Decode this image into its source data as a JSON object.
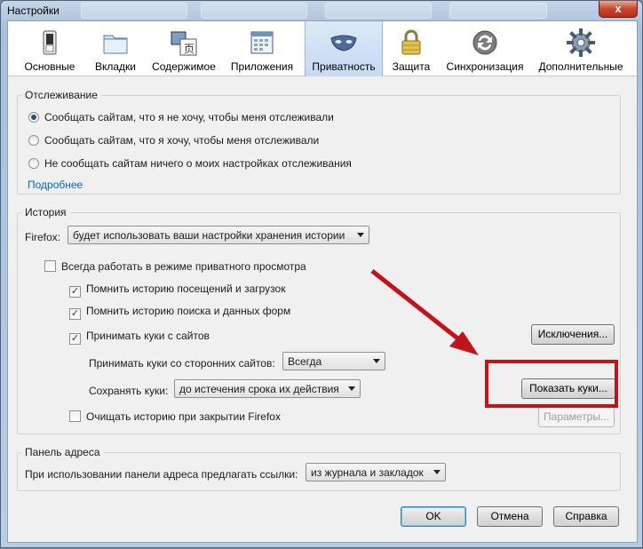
{
  "window": {
    "title": "Настройки",
    "close_label": "x"
  },
  "toolbar": {
    "items": [
      {
        "label": "Основные",
        "icon": "switch-icon"
      },
      {
        "label": "Вкладки",
        "icon": "tabs-icon"
      },
      {
        "label": "Содержимое",
        "icon": "content-icon"
      },
      {
        "label": "Приложения",
        "icon": "applications-icon"
      },
      {
        "label": "Приватность",
        "icon": "mask-icon",
        "active": true
      },
      {
        "label": "Защита",
        "icon": "lock-icon"
      },
      {
        "label": "Синхронизация",
        "icon": "sync-icon"
      },
      {
        "label": "Дополнительные",
        "icon": "gear-icon"
      }
    ]
  },
  "tracking": {
    "title": "Отслеживание",
    "options": [
      "Сообщать сайтам, что я не хочу, чтобы меня отслеживали",
      "Сообщать сайтам, что я хочу, чтобы меня отслеживали",
      "Не сообщать сайтам ничего о моих настройках отслеживания"
    ],
    "selected_index": 0,
    "more_link": "Подробнее"
  },
  "history": {
    "title": "История",
    "firefox_label": "Firefox:",
    "mode_value": "будет использовать ваши настройки хранения истории",
    "private_mode": {
      "label": "Всегда работать в режиме приватного просмотра",
      "checked": false
    },
    "remember_visits": {
      "label": "Помнить историю посещений и загрузок",
      "checked": true
    },
    "remember_search": {
      "label": "Помнить историю поиска и данных форм",
      "checked": true
    },
    "accept_cookies": {
      "label": "Принимать куки с сайтов",
      "checked": true
    },
    "exceptions_button": "Исключения...",
    "third_party_label": "Принимать куки со сторонних сайтов:",
    "third_party_value": "Всегда",
    "keep_label": "Сохранять куки:",
    "keep_value": "до истечения срока их действия",
    "show_cookies_button": "Показать куки...",
    "clear_on_close": {
      "label": "Очищать историю при закрытии Firefox",
      "checked": false
    },
    "settings_button": "Параметры..."
  },
  "address_bar": {
    "title": "Панель адреса",
    "suggest_label": "При использовании панели адреса предлагать ссылки:",
    "suggest_value": "из журнала и закладок"
  },
  "footer": {
    "ok": "OK",
    "cancel": "Отмена",
    "help": "Справка"
  },
  "colors": {
    "annotation": "#c0141a",
    "link": "#0066cc"
  }
}
